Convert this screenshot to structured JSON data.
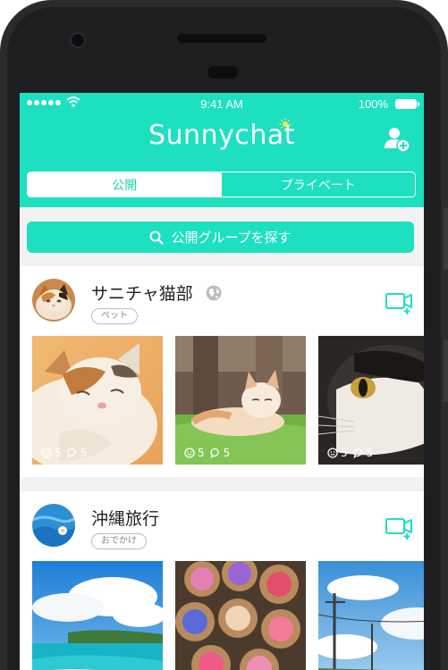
{
  "status_bar": {
    "time": "9:41 AM",
    "battery": "100%"
  },
  "header": {
    "app_name": "Sunnychat"
  },
  "tabs": [
    {
      "label": "公開"
    },
    {
      "label": "プライベート"
    }
  ],
  "search": {
    "label": "公開グループを探す"
  },
  "groups": [
    {
      "name": "サニチャ猫部",
      "tag": "ペット",
      "posts": [
        {
          "faces": "5",
          "comments": "5"
        },
        {
          "faces": "5",
          "comments": "5"
        },
        {
          "faces": "5",
          "comments": "5"
        }
      ]
    },
    {
      "name": "沖縄旅行",
      "tag": "おでかけ"
    }
  ],
  "colors": {
    "accent": "#1de0c0",
    "accent_text": "#1ccfb2",
    "phone_frame": "#2b2b2d"
  }
}
